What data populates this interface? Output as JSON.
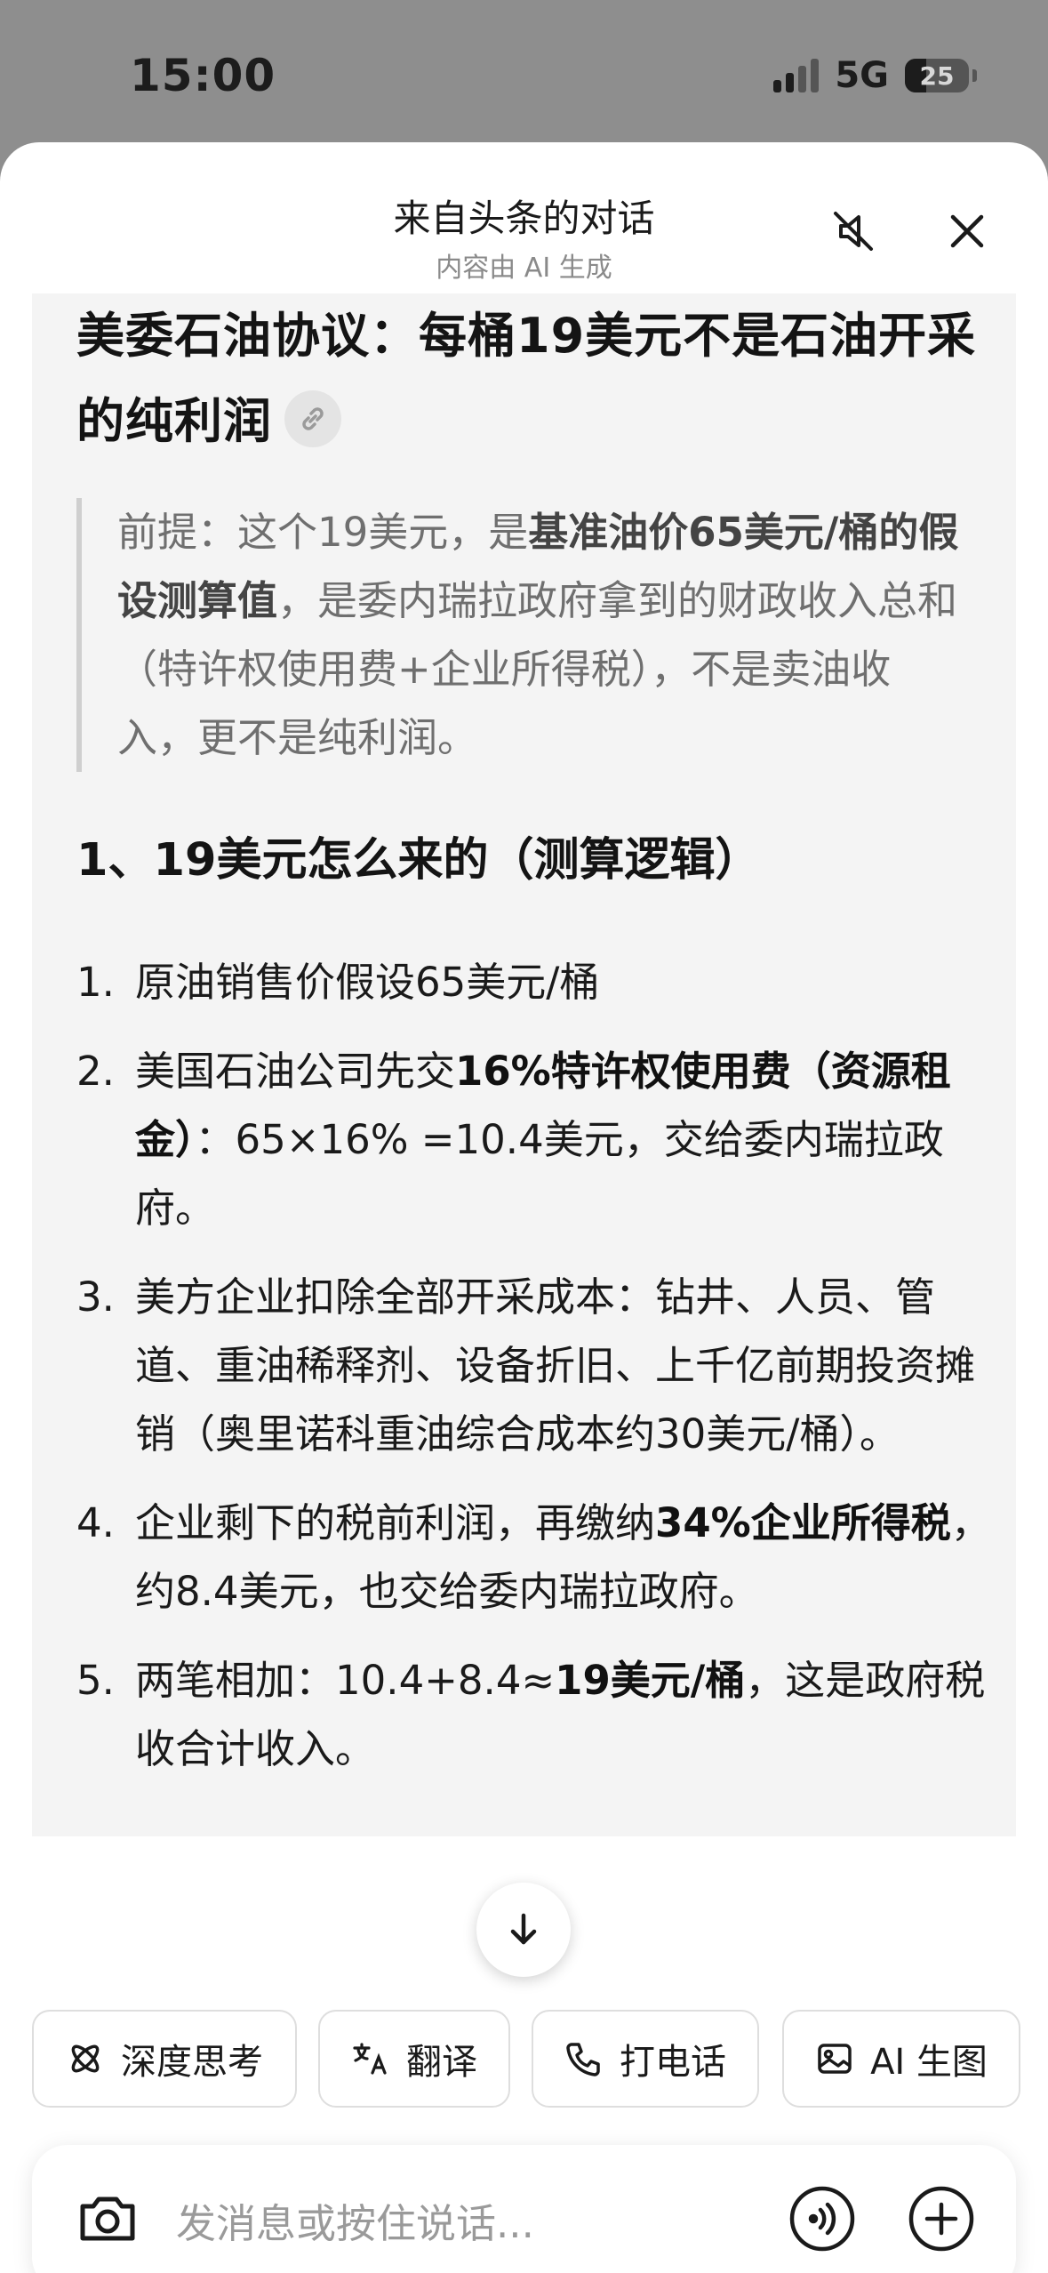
{
  "status": {
    "time": "15:00",
    "network": "5G",
    "battery": "25"
  },
  "header": {
    "title": "来自头条的对话",
    "subtitle": "内容由 AI 生成"
  },
  "article": {
    "headline": "美委石油协议：每桶19美元不是石油开采的纯利润",
    "quote": {
      "p1": "前提：这个19美元，是",
      "b1": "基准油价65美元/桶的假设测算值",
      "p2": "，是委内瑞拉政府拿到的财政收入总和（特许权使用费+企业所得税），不是卖油收入，更不是纯利润。"
    },
    "section_title": "1、19美元怎么来的（测算逻辑）",
    "steps": [
      {
        "num": "1.",
        "text": "原油销售价假设65美元/桶"
      },
      {
        "num": "2.",
        "pre": "美国石油公司先交",
        "bold": "16%特许权使用费（资源租金）",
        "post": "：65×16% =10.4美元，交给委内瑞拉政府。"
      },
      {
        "num": "3.",
        "text": "美方企业扣除全部开采成本：钻井、人员、管道、重油稀释剂、设备折旧、上千亿前期投资摊销（奥里诺科重油综合成本约30美元/桶）。"
      },
      {
        "num": "4.",
        "pre": "企业剩下的税前利润，再缴纳",
        "bold": "34%企业所得税",
        "post": "，约8.4美元，也交给委内瑞拉政府。"
      },
      {
        "num": "5.",
        "pre": "两笔相加：10.4+8.4≈",
        "bold": "19美元/桶",
        "post": "，这是政府税收合计收入。"
      }
    ]
  },
  "chips": [
    {
      "label": "深度思考",
      "icon": "atom-icon"
    },
    {
      "label": "翻译",
      "icon": "translate-icon"
    },
    {
      "label": "打电话",
      "icon": "phone-icon"
    },
    {
      "label": "AI 生图",
      "icon": "image-icon"
    }
  ],
  "input": {
    "placeholder": "发消息或按住说话..."
  }
}
